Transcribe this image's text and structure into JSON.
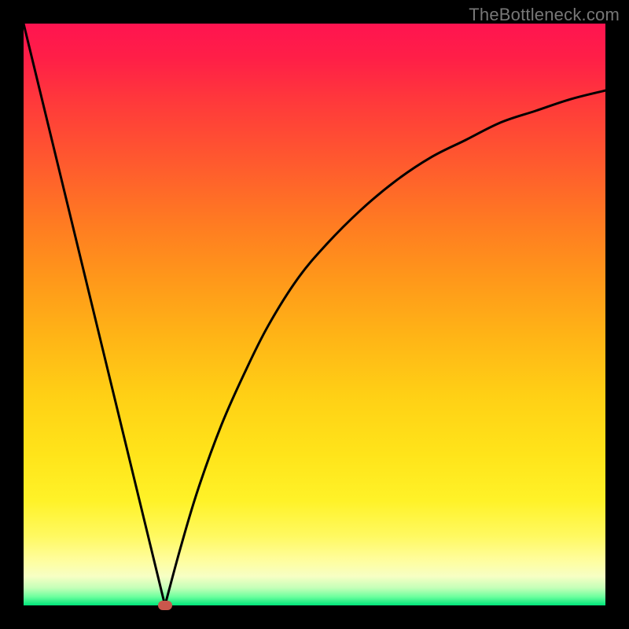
{
  "watermark": "TheBottleneck.com",
  "chart_data": {
    "type": "line",
    "title": "",
    "xlabel": "",
    "ylabel": "",
    "xlim": [
      0,
      100
    ],
    "ylim": [
      0,
      100
    ],
    "grid": false,
    "legend": false,
    "background": "rainbow-gradient (red top to green bottom)",
    "series": [
      {
        "name": "left-branch",
        "type": "line",
        "x": [
          0,
          24.3
        ],
        "y": [
          100,
          0
        ]
      },
      {
        "name": "right-branch",
        "type": "curve",
        "x": [
          24.3,
          27,
          30,
          34,
          38,
          42,
          47,
          52,
          58,
          64,
          70,
          76,
          82,
          88,
          94,
          100
        ],
        "y": [
          0,
          10,
          20,
          31,
          40,
          48,
          56,
          62,
          68,
          73,
          77,
          80,
          83,
          85,
          87,
          88.5
        ]
      }
    ],
    "minimum_marker": {
      "x": 24.3,
      "y": 0,
      "color": "#c9574c"
    }
  }
}
